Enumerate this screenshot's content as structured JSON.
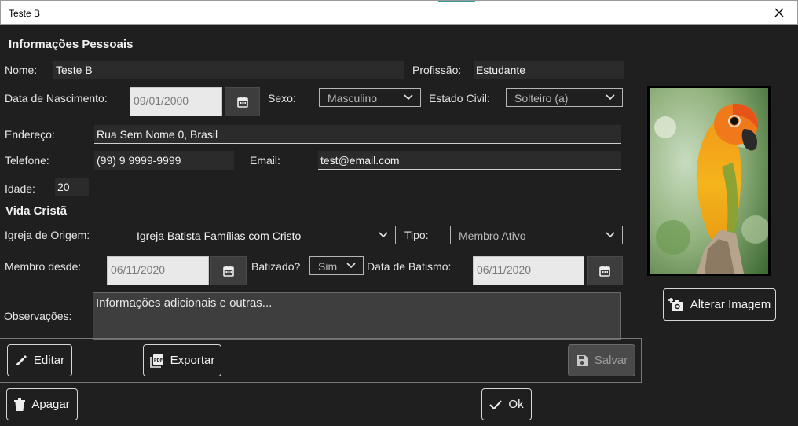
{
  "window": {
    "title": "Teste B"
  },
  "personal": {
    "section_title": "Informações Pessoais",
    "nome_label": "Nome:",
    "nome_value": "Teste B",
    "profissao_label": "Profissão:",
    "profissao_value": "Estudante",
    "nascimento_label": "Data de Nascimento:",
    "nascimento_value": "09/01/2000",
    "sexo_label": "Sexo:",
    "sexo_value": "Masculino",
    "estado_civil_label": "Estado Civil:",
    "estado_civil_value": "Solteiro (a)",
    "endereco_label": "Endereço:",
    "endereco_value": "Rua Sem Nome 0, Brasil",
    "telefone_label": "Telefone:",
    "telefone_value": "(99) 9 9999-9999",
    "email_label": "Email:",
    "email_value": "test@email.com",
    "idade_label": "Idade:",
    "idade_value": "20"
  },
  "christian": {
    "section_title": "Vida Cristã",
    "igreja_label": "Igreja de Origem:",
    "igreja_value": "Igreja Batista Famílias com Cristo",
    "tipo_label": "Tipo:",
    "tipo_value": "Membro Ativo",
    "membro_label": "Membro desde:",
    "membro_value": "06/11/2020",
    "batizado_label": "Batizado?",
    "batizado_value": "Sim",
    "batismo_label": "Data de Batismo:",
    "batismo_value": "06/11/2020",
    "obs_label": "Observações:",
    "obs_value": "Informações adicionais e outras..."
  },
  "image": {
    "change_label": "Alterar Imagem",
    "icon": "camera-plus-icon"
  },
  "buttons": {
    "editar": "Editar",
    "exportar": "Exportar",
    "salvar": "Salvar",
    "apagar": "Apagar",
    "ok": "Ok"
  },
  "colors": {
    "background": "#1f1f1f",
    "focus_underline": "#d89a3a",
    "field_bg": "#2b2b2b"
  }
}
